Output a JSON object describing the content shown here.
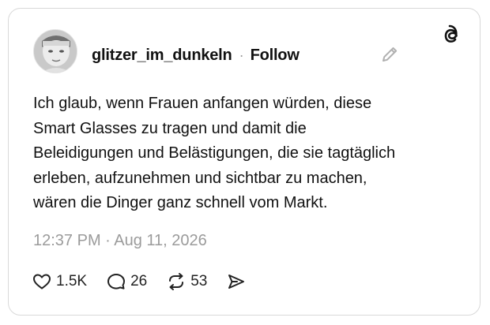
{
  "post": {
    "username": "glitzer_im_dunkeln",
    "separator": "·",
    "follow_label": "Follow",
    "text_lines": [
      "Ich glaub, wenn Frauen anfangen würden, diese",
      "Smart Glasses zu tragen und damit die",
      "Beleidigungen und Belästigungen, die sie tagtäglich",
      "erleben, aufzunehmen und sichtbar zu machen,",
      "wären die Dinger ganz schnell vom Markt."
    ],
    "timestamp": "12:37 PM · Aug 11, 2026"
  },
  "actions": {
    "likes": "1.5K",
    "replies": "26",
    "reposts": "53"
  },
  "icons": {
    "brand": "threads-logo-icon",
    "edit": "pencil-icon",
    "like": "heart-icon",
    "reply": "speech-bubble-icon",
    "repost": "repost-arrows-icon",
    "share": "send-icon"
  },
  "colors": {
    "text": "#111111",
    "muted": "#9b9b9b",
    "border": "#d9d9d9",
    "background": "#ffffff"
  }
}
